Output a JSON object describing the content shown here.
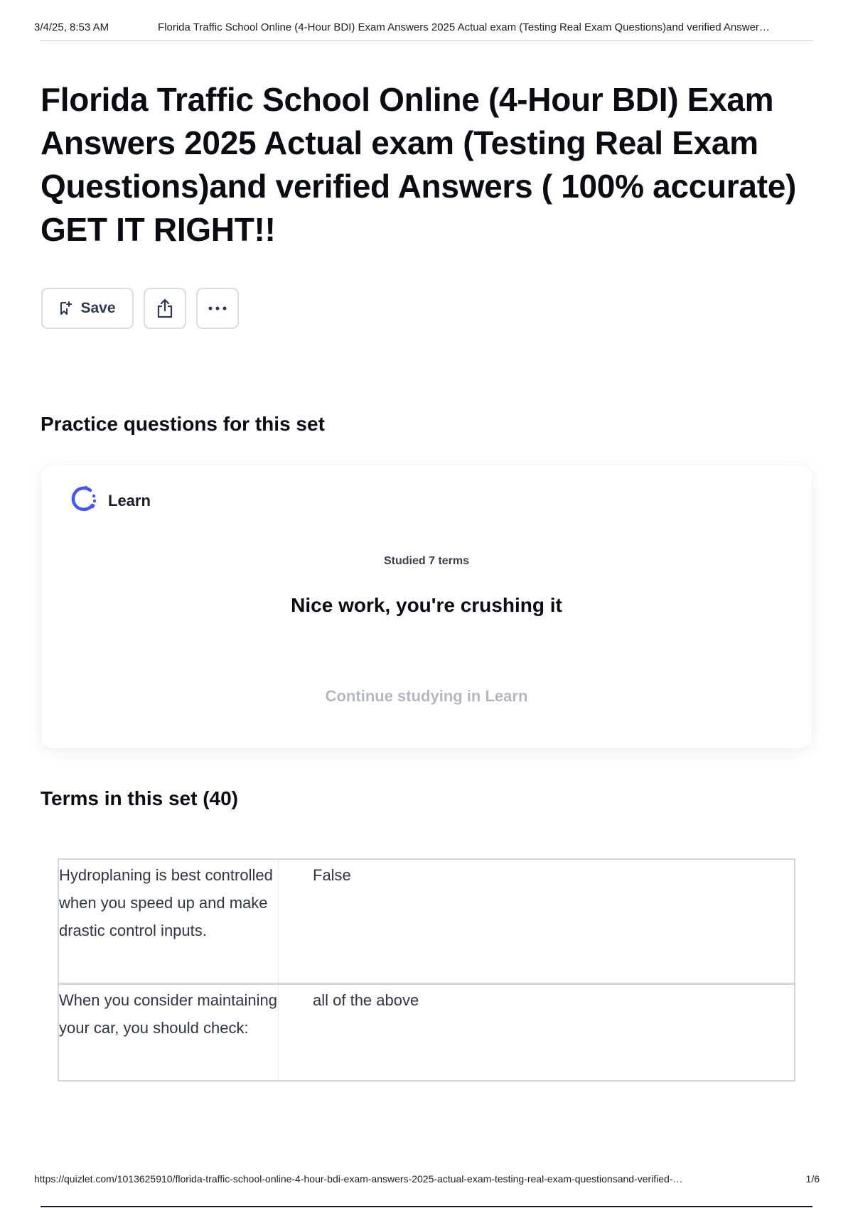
{
  "print_header": {
    "datetime": "3/4/25, 8:53 AM",
    "doc_title": "Florida Traffic School Online (4-Hour BDI) Exam Answers 2025 Actual exam (Testing Real Exam Questions)and verified Answer…"
  },
  "page": {
    "title": "Florida Traffic School Online (4-Hour BDI) Exam Answers 2025 Actual exam (Testing Real Exam Questions)and verified Answers ( 100% accurate) GET IT RIGHT!!"
  },
  "actions": {
    "save_label": "Save",
    "icons": [
      "bookmark-icon",
      "share-icon",
      "more-icon"
    ]
  },
  "practice": {
    "heading": "Practice questions for this set",
    "mode_label": "Learn",
    "progress_text": "Studied 7 terms",
    "message": "Nice work, you're crushing it",
    "continue_label": "Continue studying in Learn",
    "accent_color": "#4255ff"
  },
  "terms": {
    "heading": "Terms in this set (40)",
    "rows": [
      {
        "term": "Hydroplaning is best controlled when you speed up and make drastic control inputs.",
        "definition": "False"
      },
      {
        "term": "When you consider maintaining your car, you should check:",
        "definition": "all of the above"
      }
    ]
  },
  "print_footer": {
    "url": "https://quizlet.com/1013625910/florida-traffic-school-online-4-hour-bdi-exam-answers-2025-actual-exam-testing-real-exam-questionsand-verified-…",
    "page_indicator": "1/6"
  }
}
